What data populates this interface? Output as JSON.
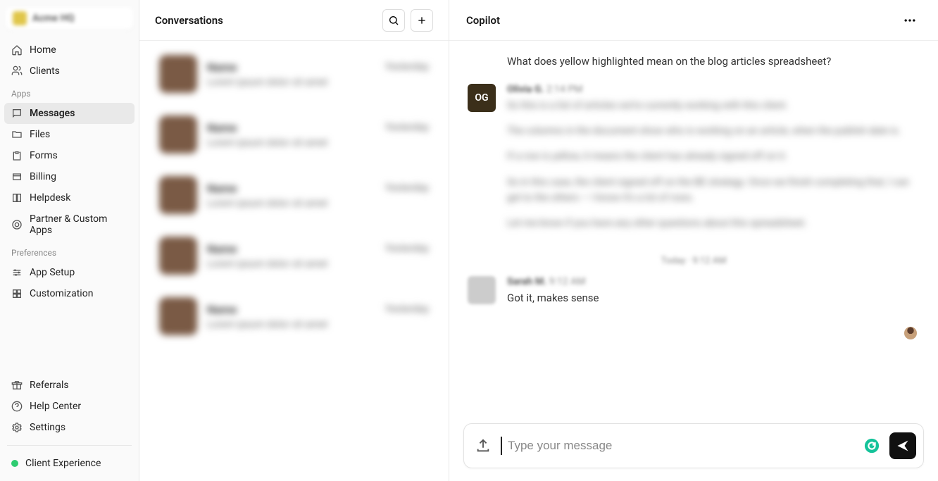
{
  "workspace": {
    "name": "Acme HQ"
  },
  "sidebar": {
    "primary": [
      {
        "label": "Home",
        "name": "home",
        "icon": "home"
      },
      {
        "label": "Clients",
        "name": "clients",
        "icon": "users"
      }
    ],
    "apps_label": "Apps",
    "apps": [
      {
        "label": "Messages",
        "name": "messages",
        "icon": "chat",
        "active": true
      },
      {
        "label": "Files",
        "name": "files",
        "icon": "folder"
      },
      {
        "label": "Forms",
        "name": "forms",
        "icon": "clipboard"
      },
      {
        "label": "Billing",
        "name": "billing",
        "icon": "billing"
      },
      {
        "label": "Helpdesk",
        "name": "helpdesk",
        "icon": "book"
      },
      {
        "label": "Partner & Custom Apps",
        "name": "partner-apps",
        "icon": "target"
      }
    ],
    "prefs_label": "Preferences",
    "prefs": [
      {
        "label": "App Setup",
        "name": "app-setup",
        "icon": "sliders"
      },
      {
        "label": "Customization",
        "name": "customization",
        "icon": "grid"
      }
    ],
    "bottom": [
      {
        "label": "Referrals",
        "name": "referrals",
        "icon": "gift"
      },
      {
        "label": "Help Center",
        "name": "help-center",
        "icon": "help"
      },
      {
        "label": "Settings",
        "name": "settings",
        "icon": "gear"
      }
    ],
    "status": {
      "label": "Client Experience"
    }
  },
  "conversations": {
    "title": "Conversations",
    "items": [
      {
        "name": "Name",
        "time": "Yesterday",
        "preview": "Lorem ipsum dolor sit amet"
      },
      {
        "name": "Name",
        "time": "Yesterday",
        "preview": "Lorem ipsum dolor sit amet"
      },
      {
        "name": "Name",
        "time": "Yesterday",
        "preview": "Lorem ipsum dolor sit amet"
      },
      {
        "name": "Name",
        "time": "Yesterday",
        "preview": "Lorem ipsum dolor sit amet"
      },
      {
        "name": "Name",
        "time": "Yesterday",
        "preview": "Lorem ipsum dolor sit amet"
      }
    ]
  },
  "copilot": {
    "title": "Copilot",
    "question": "What does yellow highlighted mean on the blog articles spreadsheet?",
    "og_initials": "OG",
    "og_meta": {
      "name": "Olivia G.",
      "time": "2:14 PM"
    },
    "og_body": [
      "So this is a list of articles we’re currently working with this client.",
      "The columns in the document show who is working on an article, when the publish date is.",
      "If a row is yellow, it means the client has already signed off on it.",
      "So in this case, the client signed off on the BE strategy. Once we finish completing that, I can get to the others — I know it’s a lot of rows.",
      "Let me know if you have any other questions about this spreadsheet."
    ],
    "divider": "Today · 9:12 AM",
    "reply_meta": {
      "name": "Sarah M.",
      "time": "9:12 AM"
    },
    "reply_text": "Got it, makes sense",
    "composer_placeholder": "Type your message"
  }
}
